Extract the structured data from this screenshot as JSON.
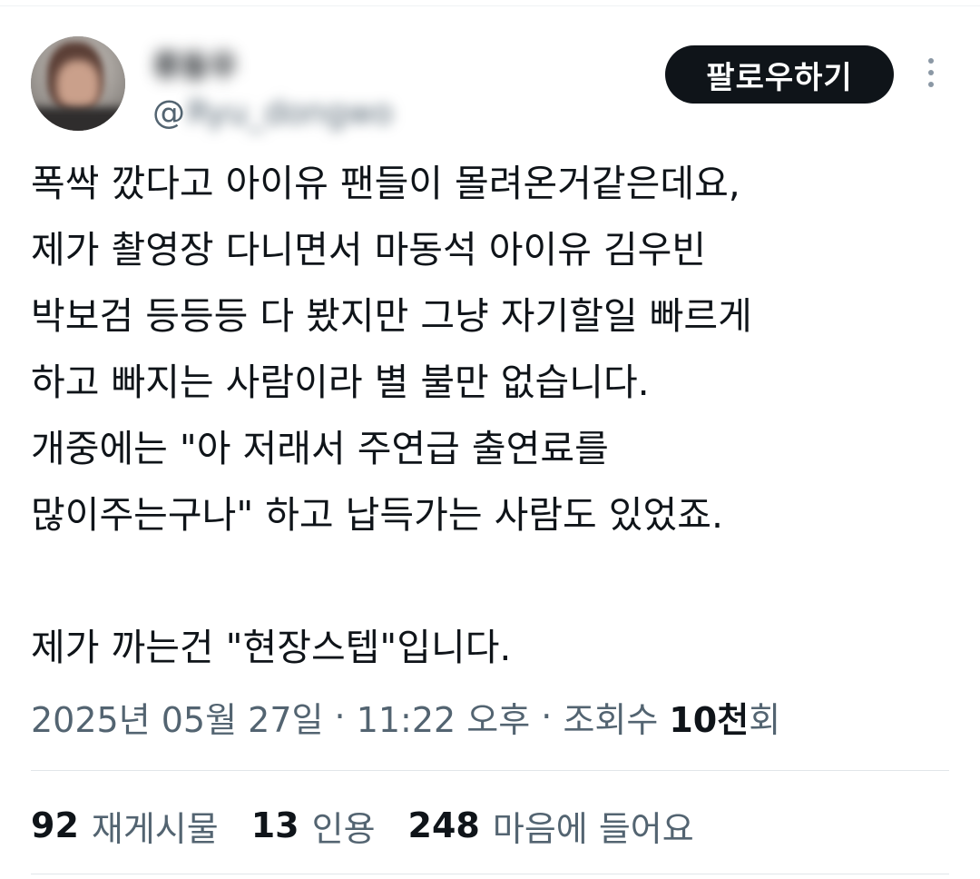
{
  "author": {
    "display_name": "류동우",
    "handle_prefix": "@",
    "handle_rest": "Ryu_dongwo"
  },
  "follow_button": {
    "label": "팔로우하기"
  },
  "tweet": {
    "lines": [
      "폭싹 깠다고 아이유 팬들이 몰려온거같은데요,",
      "제가 촬영장 다니면서 마동석 아이유 김우빈",
      "박보검 등등등 다 봤지만 그냥 자기할일 빠르게",
      "하고 빠지는 사람이라 별 불만 없습니다.",
      "개중에는 \"아 저래서 주연급 출연료를",
      "많이주는구나\" 하고 납득가는 사람도 있었죠.",
      "",
      "제가 까는건 \"현장스텝\"입니다."
    ]
  },
  "meta": {
    "date": "2025년 05월 27일",
    "separator": " · ",
    "time": "11:22 오후",
    "views_label": "조회수",
    "views_number": "10천",
    "views_suffix": "회"
  },
  "stats": {
    "reposts_num": "92",
    "reposts_label": "재게시물",
    "quotes_num": "13",
    "quotes_label": "인용",
    "likes_num": "248",
    "likes_label": "마음에 들어요"
  },
  "icons": {
    "more": "more-vertical-icon"
  },
  "colors": {
    "text_primary": "#0f1419",
    "text_secondary": "#536471",
    "button_bg": "#0f1419",
    "divider": "#e1e6e9"
  }
}
